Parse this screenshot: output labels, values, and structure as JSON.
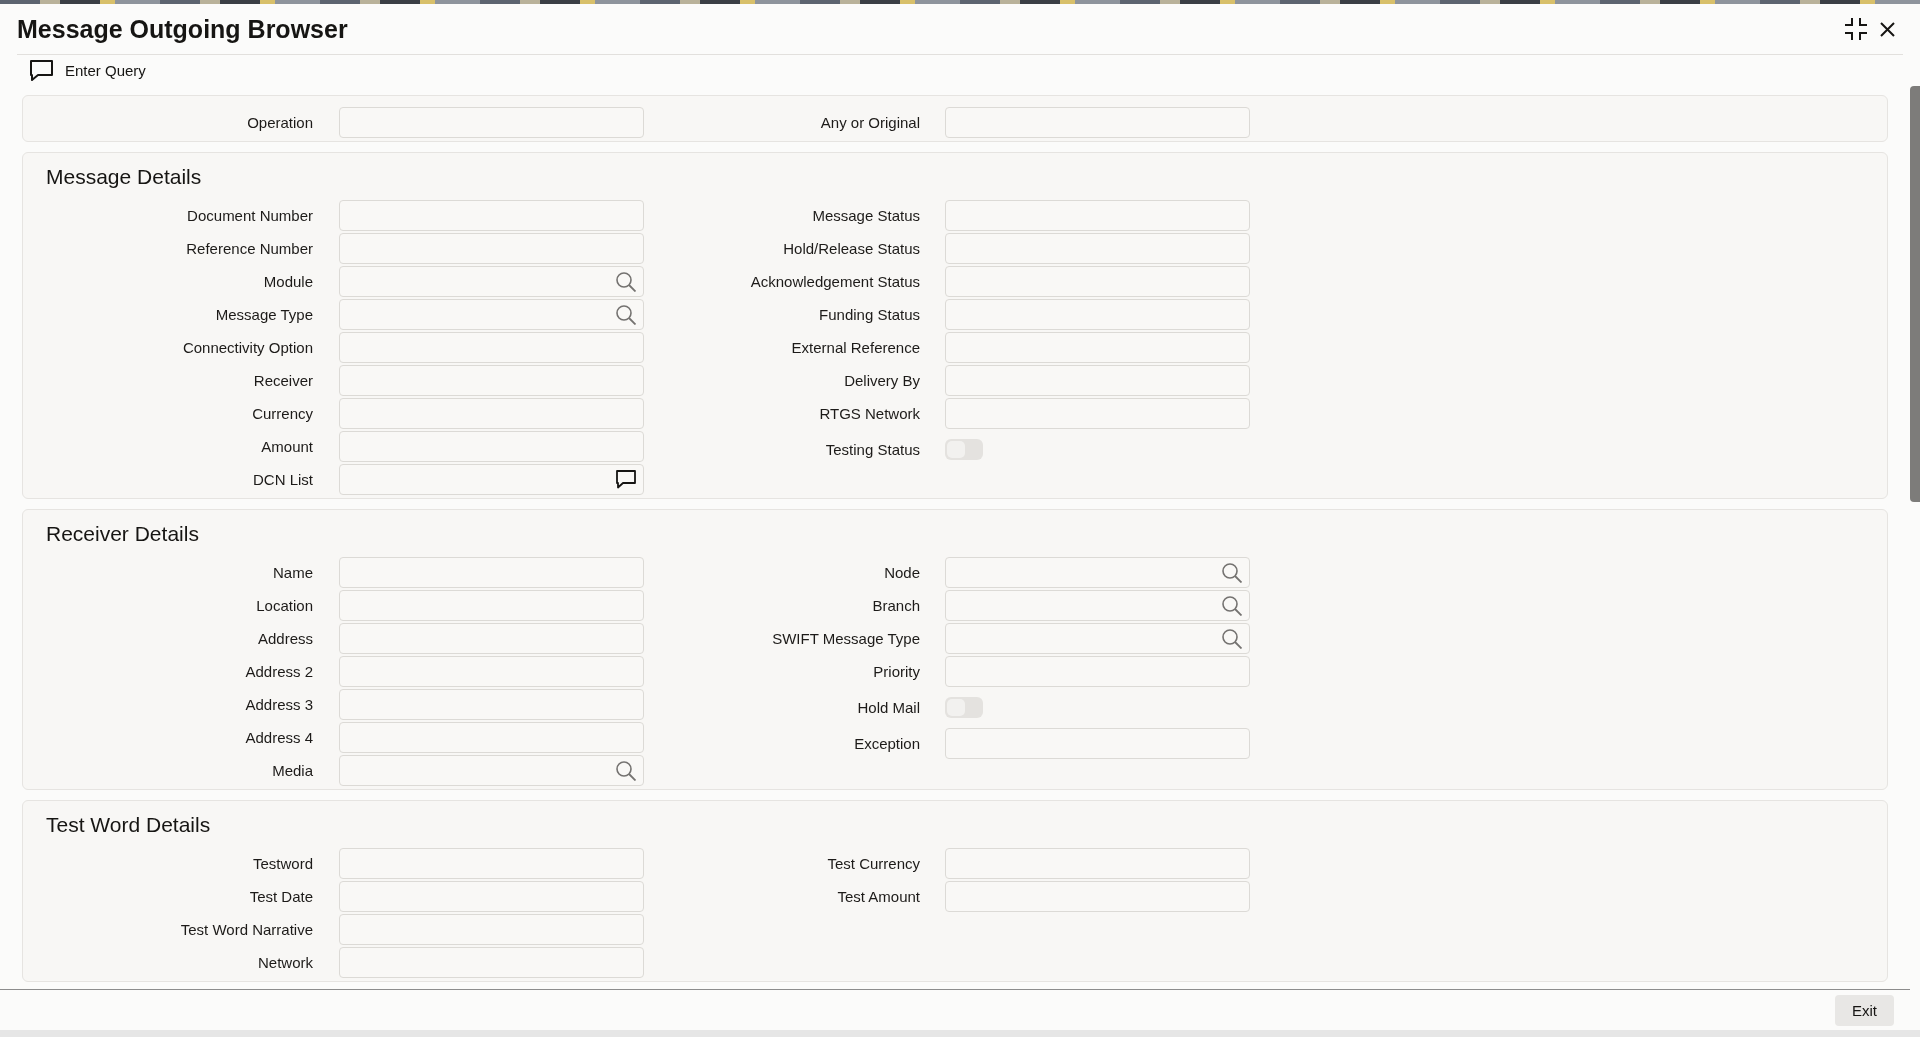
{
  "header": {
    "title": "Message Outgoing Browser"
  },
  "toolbar": [
    {
      "label": "Enter Query"
    }
  ],
  "sections": [
    {
      "left": [
        {
          "label": "Operation",
          "kind": "text"
        }
      ],
      "right": [
        {
          "label": "Any or Original",
          "kind": "text"
        }
      ]
    },
    {
      "heading": "Message Details",
      "left": [
        {
          "label": "Document Number",
          "kind": "text"
        },
        {
          "label": "Reference Number",
          "kind": "text"
        },
        {
          "label": "Module",
          "kind": "search"
        },
        {
          "label": "Message Type",
          "kind": "search"
        },
        {
          "label": "Connectivity Option",
          "kind": "text"
        },
        {
          "label": "Receiver",
          "kind": "text"
        },
        {
          "label": "Currency",
          "kind": "text"
        },
        {
          "label": "Amount",
          "kind": "text"
        },
        {
          "label": "DCN List",
          "kind": "list"
        }
      ],
      "right": [
        {
          "label": "Message Status",
          "kind": "text"
        },
        {
          "label": "Hold/Release Status",
          "kind": "text"
        },
        {
          "label": "Acknowledgement Status",
          "kind": "text"
        },
        {
          "label": "Funding Status",
          "kind": "text"
        },
        {
          "label": "External Reference",
          "kind": "text"
        },
        {
          "label": "Delivery By",
          "kind": "text"
        },
        {
          "label": "RTGS Network",
          "kind": "text"
        },
        {
          "label": "Testing Status",
          "kind": "toggle",
          "on": false
        }
      ]
    },
    {
      "heading": "Receiver Details",
      "left": [
        {
          "label": "Name",
          "kind": "text"
        },
        {
          "label": "Location",
          "kind": "text"
        },
        {
          "label": "Address",
          "kind": "text"
        },
        {
          "label": "Address 2",
          "kind": "text"
        },
        {
          "label": "Address 3",
          "kind": "text"
        },
        {
          "label": "Address 4",
          "kind": "text"
        },
        {
          "label": "Media",
          "kind": "search"
        }
      ],
      "right": [
        {
          "label": "Node",
          "kind": "search"
        },
        {
          "label": "Branch",
          "kind": "search"
        },
        {
          "label": "SWIFT Message Type",
          "kind": "search"
        },
        {
          "label": "Priority",
          "kind": "text"
        },
        {
          "label": "Hold Mail",
          "kind": "toggle",
          "on": false
        },
        {
          "label": "Exception",
          "kind": "text"
        }
      ]
    },
    {
      "heading": "Test Word Details",
      "left": [
        {
          "label": "Testword",
          "kind": "text"
        },
        {
          "label": "Test Date",
          "kind": "text"
        },
        {
          "label": "Test Word Narrative",
          "kind": "text"
        },
        {
          "label": "Network",
          "kind": "text"
        }
      ],
      "right": [
        {
          "label": "Test Currency",
          "kind": "text"
        },
        {
          "label": "Test Amount",
          "kind": "text"
        }
      ]
    }
  ],
  "footer": {
    "buttons": [
      {
        "label": "Exit"
      }
    ]
  }
}
